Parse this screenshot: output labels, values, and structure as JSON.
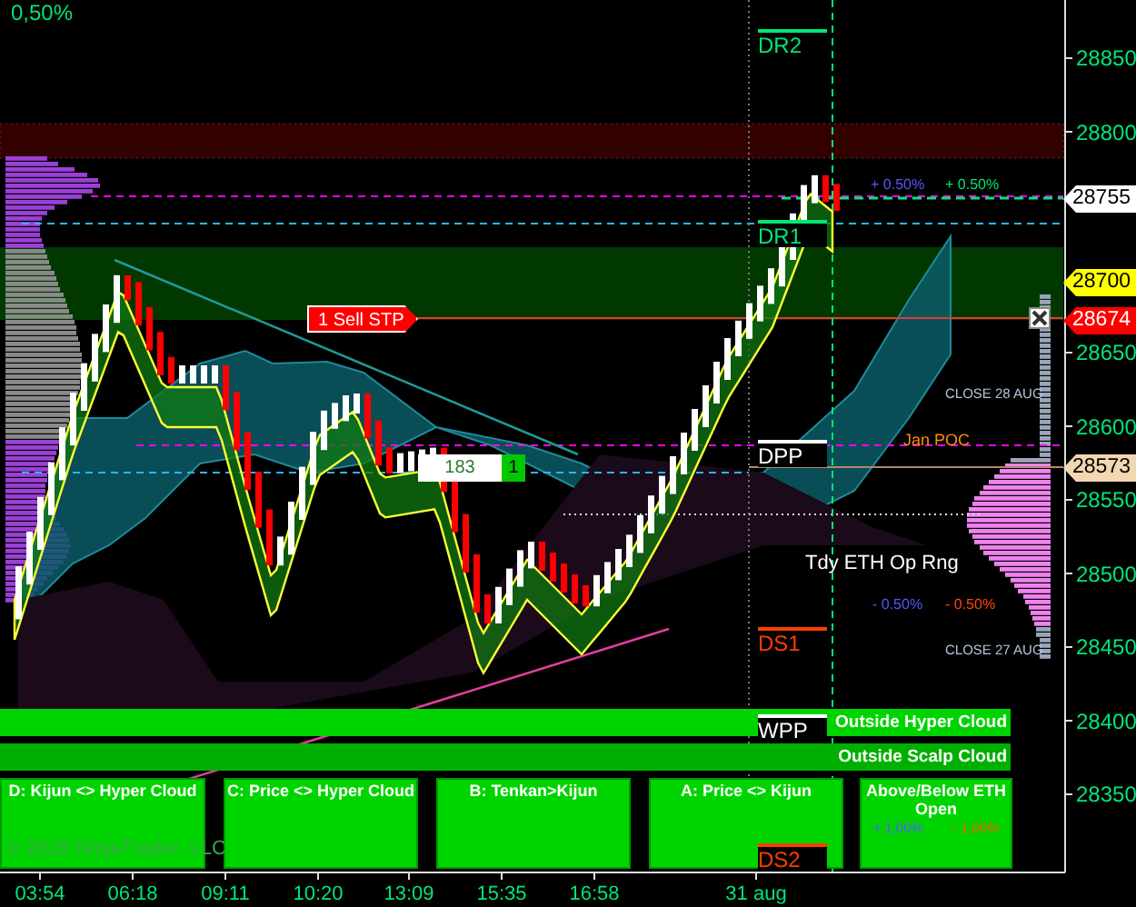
{
  "top_label": "0,50%",
  "price_axis": {
    "ticks": [
      "28850",
      "28800",
      "28650",
      "28600",
      "28550",
      "28500",
      "28450",
      "28400",
      "28350"
    ]
  },
  "price_markers": [
    {
      "text": "28755",
      "color": "#ffffff"
    },
    {
      "text": "28700",
      "color": "#ffff00"
    },
    {
      "text": "28674",
      "color": "#ff0000"
    },
    {
      "text": "28573",
      "color": "#f2d7b0"
    }
  ],
  "level_labels": [
    {
      "text": "DR2",
      "color": "#00e676"
    },
    {
      "text": "DR1",
      "color": "#00e676"
    },
    {
      "text": "DPP",
      "color": "#ffffff"
    },
    {
      "text": "DS1",
      "color": "#ff3d00"
    },
    {
      "text": "WPP",
      "color": "#ffffff"
    },
    {
      "text": "DS2",
      "color": "#ff3d00"
    }
  ],
  "annotations": [
    {
      "text": "+ 0.50%",
      "color": "#5555ff"
    },
    {
      "text": "+ 0.50%",
      "color": "#00e676"
    },
    {
      "text": "CLOSE 28 AUG",
      "color": "#b0c4de"
    },
    {
      "text": "Jan POC",
      "color": "#ff8c00"
    },
    {
      "text": "Tdy ETH Op Rng",
      "color": "#ffffff"
    },
    {
      "text": "- 0.50%",
      "color": "#5555ff"
    },
    {
      "text": "- 0.50%",
      "color": "#ff4500"
    },
    {
      "text": "CLOSE 27 AUG",
      "color": "#b0c4de"
    }
  ],
  "order": {
    "label": "1 Sell STP"
  },
  "position": {
    "value": "183",
    "quantity": "1"
  },
  "cloud_bars": [
    "Outside Hyper Cloud",
    "Outside Scalp Cloud"
  ],
  "signal_boxes": [
    {
      "title": "D: Kijun <> Hyper Cloud"
    },
    {
      "title": "C: Price <> Hyper Cloud"
    },
    {
      "title": "B: Tenkan>Kijun"
    },
    {
      "title": "A: Price <> Kijun"
    },
    {
      "title": "Above/Below ETH Open",
      "up": "+ 1,00%",
      "down": "- 1,00%"
    }
  ],
  "copyright": "© 2020 NinjaTrader, LLC",
  "time_axis": [
    "03:54",
    "06:18",
    "09:11",
    "10:20",
    "13:09",
    "15:35",
    "16:58",
    "31 aug"
  ]
}
